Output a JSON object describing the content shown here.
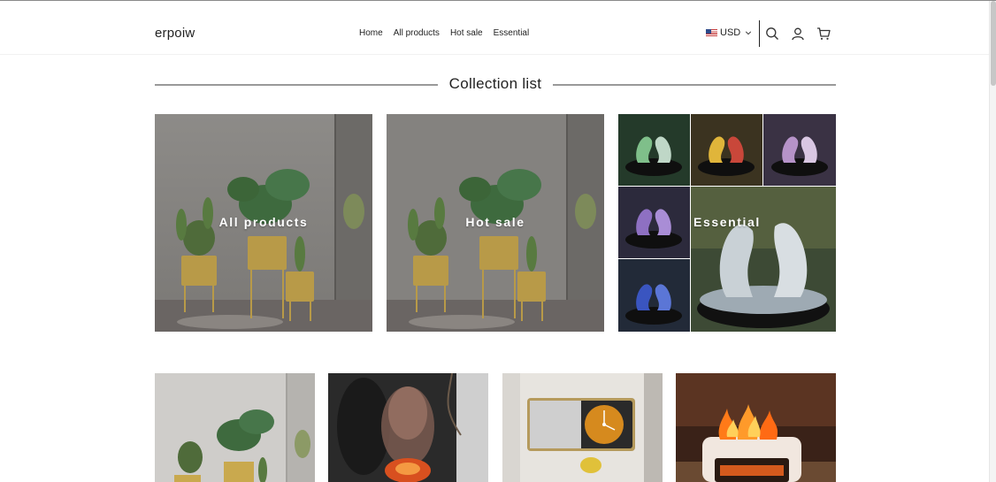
{
  "header": {
    "logo": "erpoiw",
    "nav": [
      "Home",
      "All products",
      "Hot sale",
      "Essential"
    ],
    "currency": "USD",
    "icons": [
      "search-icon",
      "account-icon",
      "cart-icon"
    ]
  },
  "section": {
    "title": "Collection list"
  },
  "collections": [
    {
      "label": "All products"
    },
    {
      "label": "Hot sale"
    },
    {
      "label": "Essential"
    }
  ],
  "colors": {
    "text": "#222222",
    "accent": "#ffffff",
    "divider": "#999999"
  }
}
